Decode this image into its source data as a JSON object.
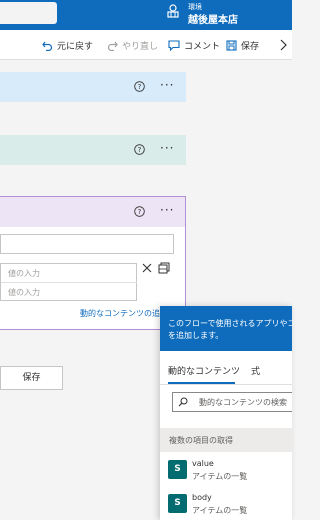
{
  "header": {
    "environment_label": "環境",
    "environment_name": "越後屋本店"
  },
  "toolbar": {
    "undo": "元に戻す",
    "redo": "やり直し",
    "comment": "コメント",
    "save": "保存"
  },
  "action_card": {
    "key_placeholder": "値の入力",
    "value_placeholder": "値の入力",
    "dynamic_content_link": "動的なコンテンツの追加"
  },
  "footer": {
    "save_label": "保存"
  },
  "flyout": {
    "header_line1": "このフローで使用されるアプリやコネ",
    "header_line2": "を追加します。",
    "tab_dynamic": "動的なコンテンツ",
    "tab_expression": "式",
    "search_placeholder": "動的なコンテンツの検索",
    "section_title": "複数の項目の取得",
    "items": [
      {
        "name": "value",
        "subtitle": "アイテムの一覧",
        "icon_letter": "S"
      },
      {
        "name": "body",
        "subtitle": "アイテムの一覧",
        "icon_letter": "S"
      }
    ]
  },
  "colors": {
    "accent": "#0f6cbd",
    "step1": "#d7ebfb",
    "step2": "#d9ece9",
    "step3": "#ede5f6",
    "sharepoint": "#036c70"
  }
}
